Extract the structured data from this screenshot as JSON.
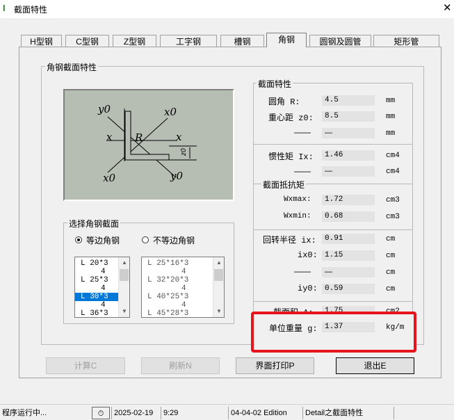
{
  "window": {
    "title": "截面特性",
    "app_icon": "I-icon"
  },
  "tabs": [
    "H型钢",
    "C型钢",
    "Z型钢",
    "工字钢",
    "槽钢",
    "角钢",
    "圆钢及圆管",
    "矩形管"
  ],
  "active_tab": "角钢",
  "main_group_label": "角钢截面特性",
  "diagram_labels": {
    "y0_top": "y0",
    "x0_top": "x0",
    "x_left": "x",
    "x_right": "x",
    "R": "R",
    "z0": "z0",
    "x0_bottom": "x0",
    "y0_bottom": "y0"
  },
  "select_group": {
    "label": "选择角钢截面",
    "radio_equal": "等边角钢",
    "radio_unequal": "不等边角钢",
    "selected_radio": "等边角钢",
    "list_equal": [
      "L 20*3",
      "4",
      "L 25*3",
      "4",
      "L 30*3",
      "4",
      "L 36*3"
    ],
    "list_equal_selected": "L 30*3",
    "list_unequal": [
      "L 25*16*3",
      "4",
      "L 32*20*3",
      "4",
      "L 40*25*3",
      "4",
      "L 45*28*3"
    ]
  },
  "props": {
    "section_label": "截面特性",
    "r_label": "圆角    R:",
    "r_value": "4.5",
    "r_unit": "mm",
    "z0_label": "重心距 z0:",
    "z0_value": "8.5",
    "z0_unit": "mm",
    "blank1_label": "——",
    "blank1_value": "—",
    "blank1_unit": "mm",
    "ix_label": "惯性矩 Ix:",
    "ix_value": "1.46",
    "ix_unit": "cm4",
    "blank2_label": "——",
    "blank2_value": "—",
    "blank2_unit": "cm4",
    "modulus_label": "截面抵抗矩",
    "wxmax_label": "Wxmax:",
    "wxmax_value": "1.72",
    "wxmax_unit": "cm3",
    "wxmin_label": "Wxmin:",
    "wxmin_value": "0.68",
    "wxmin_unit": "cm3",
    "radius_label": "回转半径 ix:",
    "radius_ix_value": "0.91",
    "radius_ix_unit": "cm",
    "ix0_label": "ix0:",
    "ix0_value": "1.15",
    "ix0_unit": "cm",
    "blank3_label": "——",
    "blank3_value": "—",
    "blank3_unit": "cm",
    "iy0_label": "iy0:",
    "iy0_value": "0.59",
    "iy0_unit": "cm",
    "area_label": "截面积 A:",
    "area_value": "1.75",
    "area_unit": "cm2",
    "weight_label": "单位重量 g:",
    "weight_value": "1.37",
    "weight_unit": "kg/m"
  },
  "buttons": {
    "calc": "计算C",
    "refresh": "刷新N",
    "print": "界面打印P",
    "exit": "退出E"
  },
  "statusbar": {
    "status": "程序运行中...",
    "date": "2025-02-19",
    "time": "9:29",
    "edition": "04-04-02 Edition",
    "detail": "Detail之截面特性"
  },
  "colors": {
    "highlight_box": "#e8141b",
    "selection": "#0078d7",
    "diagram_bg": "#b6bdb3"
  }
}
